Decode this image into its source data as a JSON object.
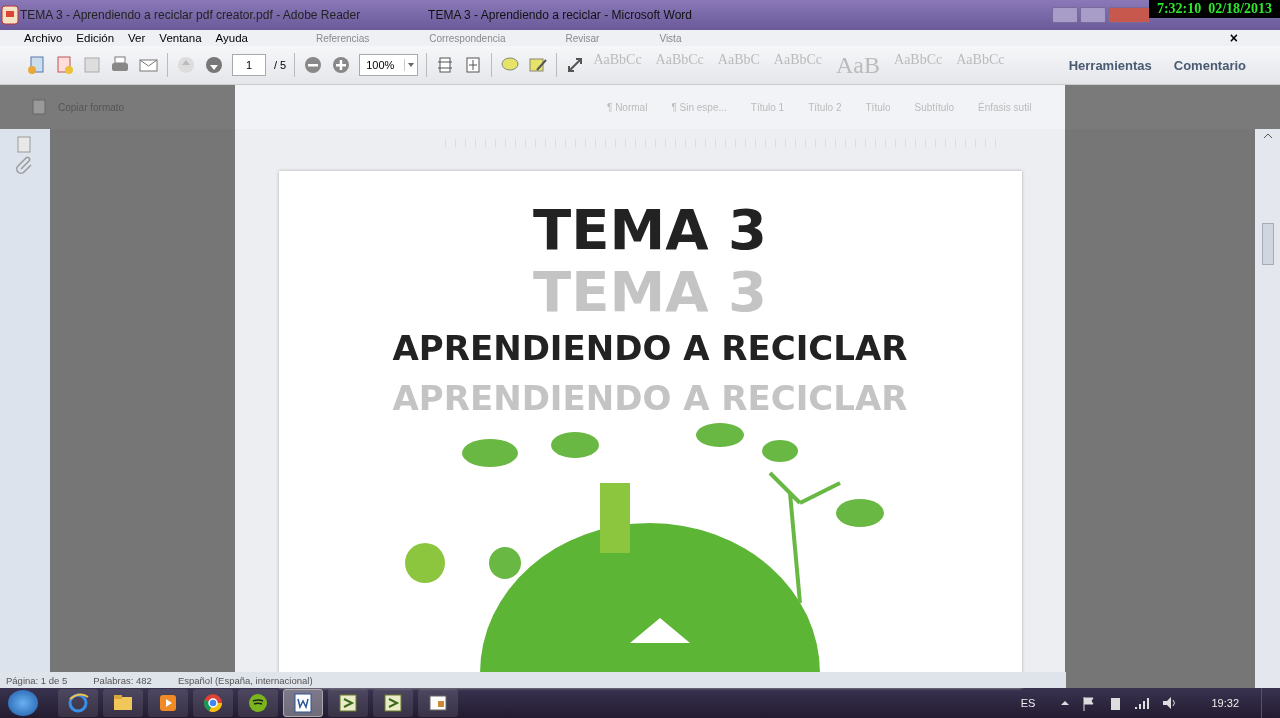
{
  "reader": {
    "title": "TEMA 3 - Aprendiendo a reciclar pdf creator.pdf - Adobe Reader",
    "menu": [
      "Archivo",
      "Edición",
      "Ver",
      "Ventana",
      "Ayuda"
    ],
    "page_number": "1",
    "page_total": "/ 5",
    "zoom": "100%",
    "panels": [
      "Herramientas",
      "Comentario"
    ],
    "close": "×"
  },
  "word": {
    "title": "TEMA 3 - Aprendiendo a reciclar - Microsoft Word",
    "tabs": [
      "Referencias",
      "Correspondencia",
      "Revisar",
      "Vista"
    ],
    "clipboard": "Copiar formato",
    "styles": [
      {
        "preview": "AaBbCc",
        "name": "¶ Normal"
      },
      {
        "preview": "AaBbCc",
        "name": "¶ Sin espe..."
      },
      {
        "preview": "AaBbC",
        "name": "Título 1"
      },
      {
        "preview": "AaBbCc",
        "name": "Título 2"
      },
      {
        "preview": "AaB",
        "name": "Título"
      },
      {
        "preview": "AaBbCc",
        "name": "Subtítulo"
      },
      {
        "preview": "AaBbCc",
        "name": "Énfasis sutil"
      }
    ],
    "status": [
      "Página: 1 de 5",
      "Palabras: 482",
      "Español (España, internacional)"
    ]
  },
  "document": {
    "lines": [
      {
        "text": "TEMA 3",
        "kind": "title",
        "faded": false
      },
      {
        "text": "TEMA 3",
        "kind": "title",
        "faded": true
      },
      {
        "text": "APRENDIENDO A RECICLAR",
        "kind": "subtitle",
        "faded": false
      },
      {
        "text": "APRENDIENDO A RECICLAR",
        "kind": "subtitle",
        "faded": true
      }
    ]
  },
  "taskbar": {
    "apps": [
      {
        "kind": "browser-e",
        "selected": false
      },
      {
        "kind": "folder",
        "selected": false
      },
      {
        "kind": "player",
        "selected": false
      },
      {
        "kind": "browser-c",
        "selected": false
      },
      {
        "kind": "music",
        "selected": false
      },
      {
        "kind": "word",
        "selected": true
      },
      {
        "kind": "sheet",
        "selected": false
      },
      {
        "kind": "sheet",
        "selected": false
      },
      {
        "kind": "reader",
        "selected": false
      }
    ],
    "language": "ES",
    "time": "19:32"
  },
  "clock_overlay": "7:32:10  02/18/2013"
}
